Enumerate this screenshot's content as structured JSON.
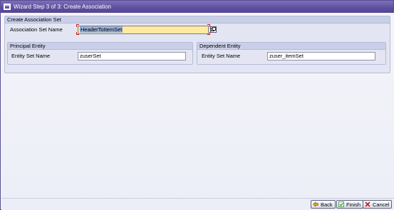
{
  "window": {
    "title": "Wizard Step 3 of 3: Create Association"
  },
  "association_set": {
    "group_title": "Create Association Set",
    "name_label": "Association Set Name",
    "name_value": "HeaderToItemSet"
  },
  "principal_entity": {
    "group_title": "Principal Entity",
    "field_label": "Entity Set Name",
    "field_value": "zuserSet"
  },
  "dependent_entity": {
    "group_title": "Dependent Entity",
    "field_label": "Entity Set Name",
    "field_value": "zuser_itemSet"
  },
  "buttons": {
    "back_label": "Back",
    "finish_label": "Finish",
    "cancel_label": "Cancel"
  },
  "colors": {
    "title_bar": "#5d4f9e",
    "active_field": "#ffeaa0",
    "selection": "#98b2d8",
    "cancel_icon": "#c81818",
    "finish_icon": "#2e8b2e"
  },
  "icons": {
    "window": "window-icon",
    "value_help": "value-help-icon",
    "back": "back-arrow-icon",
    "finish": "finish-checkflag-icon",
    "cancel": "cancel-x-icon"
  }
}
